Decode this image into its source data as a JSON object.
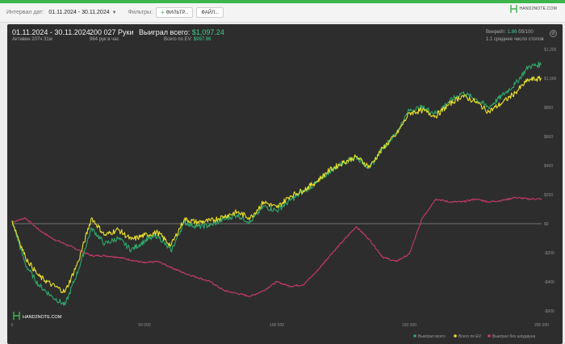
{
  "toolbar": {
    "date_interval_label": "Интервал дат:",
    "date_interval_value": "01.11.2024 - 30.11.2024",
    "filters_label": "Фильтры:",
    "filter_button_label": "ФИЛЬТР...",
    "file_button_label": "ФАЙЛ...",
    "brand_text": "HAND2NOTE.COM"
  },
  "summary": {
    "period": "01.11.2024 - 30.11.2024",
    "active_time": "Активен 207ч 31м",
    "hands": "200 027 Руки",
    "hands_per_hour": "964 рук в час",
    "won_total_label": "Выиграл всего:",
    "won_total_value": "$1,097.24",
    "ev_total_label": "Всего по EV:",
    "ev_total_value": "$997.96",
    "vinrate_label": "Винрейт:",
    "vinrate_value": "1.86",
    "vinrate_unit": "бб/100",
    "avg_tables": "1.1 среднее число столов",
    "watermark": "HAND2NOTE.COM"
  },
  "chart_data": {
    "type": "line",
    "title": "",
    "xlabel": "",
    "ylabel": "",
    "xlim": [
      0,
      200000
    ],
    "ylim": [
      -600,
      1200
    ],
    "x_ticks": [
      "0",
      "50 000",
      "100 000",
      "150 000",
      "200 000"
    ],
    "y_ticks": [
      "$1,200",
      "$1,000",
      "$800",
      "$600",
      "$400",
      "$200",
      "$0",
      "-$200",
      "-$400",
      "-$600"
    ],
    "grid": false,
    "legend_position": "bottom-right",
    "x": [
      0,
      5000,
      10000,
      15000,
      20000,
      25000,
      30000,
      35000,
      40000,
      45000,
      50000,
      55000,
      60000,
      65000,
      70000,
      75000,
      80000,
      85000,
      90000,
      95000,
      100000,
      105000,
      110000,
      115000,
      120000,
      125000,
      130000,
      135000,
      140000,
      145000,
      150000,
      155000,
      160000,
      165000,
      170000,
      175000,
      180000,
      185000,
      190000,
      195000,
      200000
    ],
    "series": [
      {
        "name": "Выиграл всего",
        "color": "#2fa86a",
        "values": [
          20,
          -280,
          -420,
          -500,
          -560,
          -320,
          -30,
          -140,
          -100,
          -180,
          -120,
          -80,
          -190,
          10,
          -20,
          -10,
          30,
          60,
          10,
          120,
          90,
          160,
          220,
          280,
          360,
          420,
          460,
          380,
          520,
          620,
          780,
          800,
          760,
          840,
          900,
          860,
          800,
          880,
          960,
          1080,
          1097
        ]
      },
      {
        "name": "Всего по EV",
        "color": "#e8e02a",
        "values": [
          20,
          -230,
          -360,
          -420,
          -470,
          -260,
          40,
          -80,
          -40,
          -110,
          -80,
          -60,
          -150,
          30,
          10,
          20,
          50,
          80,
          40,
          150,
          110,
          190,
          230,
          290,
          370,
          420,
          460,
          390,
          520,
          610,
          760,
          780,
          740,
          820,
          880,
          840,
          770,
          830,
          900,
          990,
          998
        ]
      },
      {
        "name": "Выиграл без шоудауна",
        "color": "#c83a68",
        "values": [
          10,
          40,
          -40,
          -100,
          -140,
          -180,
          -220,
          -220,
          -230,
          -250,
          -270,
          -260,
          -300,
          -340,
          -370,
          -400,
          -460,
          -480,
          -500,
          -460,
          -400,
          -430,
          -420,
          -330,
          -220,
          -120,
          -20,
          -110,
          -230,
          -260,
          -210,
          40,
          170,
          150,
          150,
          170,
          150,
          160,
          180,
          170,
          170
        ]
      }
    ]
  }
}
